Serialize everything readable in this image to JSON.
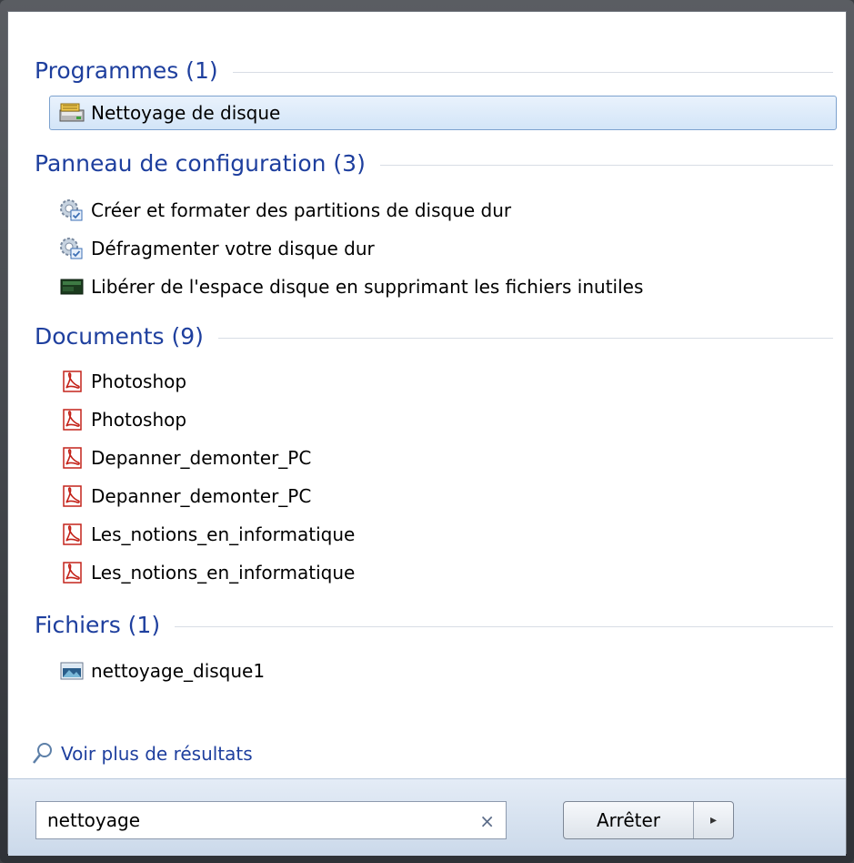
{
  "groups": {
    "programmes": {
      "title": "Programmes (1)",
      "items": [
        "Nettoyage de disque"
      ]
    },
    "panneau": {
      "title": "Panneau de configuration (3)",
      "items": [
        "Créer et formater des partitions de disque dur",
        "Défragmenter votre disque dur",
        "Libérer de l'espace disque en supprimant les fichiers inutiles"
      ]
    },
    "documents": {
      "title": "Documents (9)",
      "items": [
        "Photoshop",
        "Photoshop",
        "Depanner_demonter_PC",
        "Depanner_demonter_PC",
        "Les_notions_en_informatique",
        "Les_notions_en_informatique"
      ]
    },
    "fichiers": {
      "title": "Fichiers (1)",
      "items": [
        "nettoyage_disque1"
      ]
    }
  },
  "more_results": "Voir plus de résultats",
  "search": {
    "value": "nettoyage",
    "clear": "×"
  },
  "stop_button": {
    "label": "Arrêter",
    "arrow": "▸"
  },
  "icons": {
    "programmes": "disk-cleanup-icon",
    "panneau": [
      "control-panel-gear-icon",
      "control-panel-gear-icon",
      "disk-space-icon"
    ],
    "documents": "pdf-icon",
    "fichiers": "image-file-icon",
    "more": "magnifier-icon"
  },
  "colors": {
    "header": "#1e3f9e",
    "selection": "#d3e5f8",
    "pdf_red": "#c4241b"
  }
}
